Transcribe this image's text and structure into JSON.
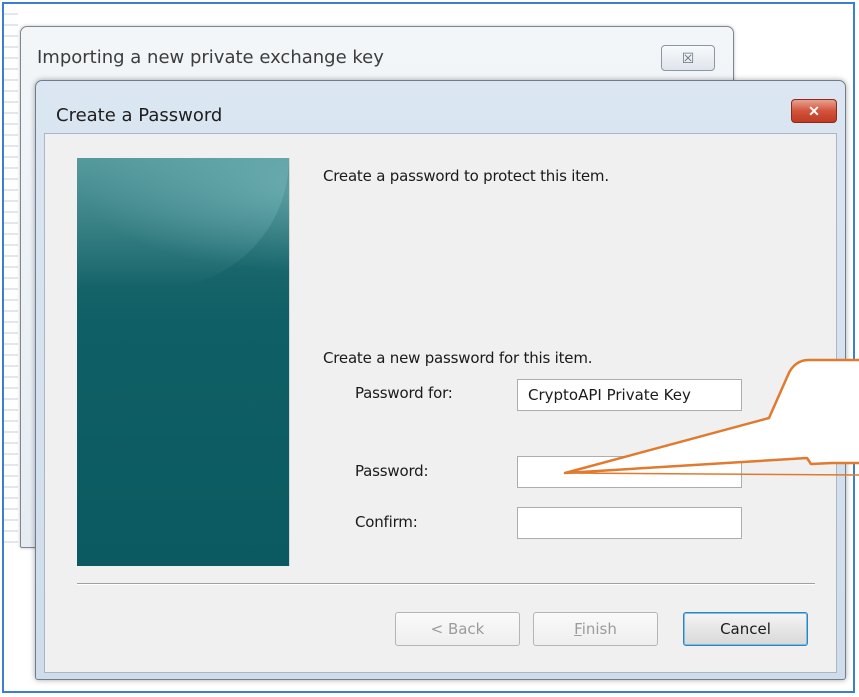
{
  "background_dialog": {
    "title": "Importing a new private exchange key",
    "close_glyph": "☒"
  },
  "dialog": {
    "title": "Create a Password",
    "close_glyph": "✕",
    "intro": "Create a password to protect this item.",
    "subheading": "Create a new password for this item.",
    "password_for_label": "Password for:",
    "password_for_value": "CryptoAPI Private Key",
    "password_label": "Password:",
    "password_value": "",
    "confirm_label": "Confirm:",
    "confirm_value": "",
    "buttons": {
      "back": "< Back",
      "finish_accel": "F",
      "finish_rest": "inish",
      "cancel": "Cancel"
    }
  },
  "colors": {
    "frame": "#3a7fd0",
    "callout": "#e07a2e",
    "side_panel": "#0f5f66"
  }
}
